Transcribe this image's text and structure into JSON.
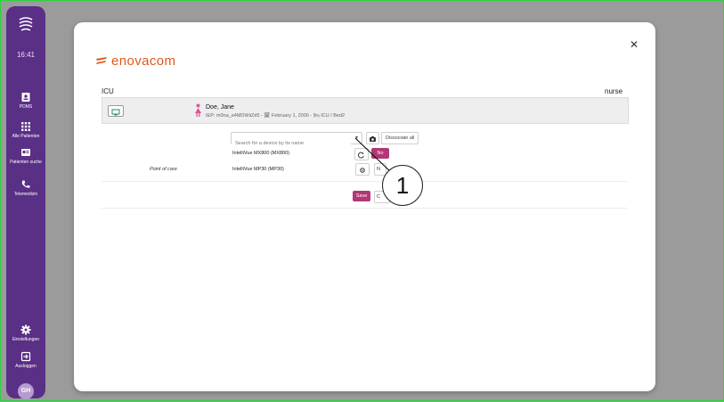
{
  "sidebar": {
    "time": "16:41",
    "items": [
      {
        "label": "PDMS",
        "icon": "badge-icon"
      },
      {
        "label": "Alle Patienten",
        "icon": "grid-icon"
      },
      {
        "label": "Patienten suche",
        "icon": "search-card-icon"
      },
      {
        "label": "Telemedizin",
        "icon": "phone-icon"
      }
    ],
    "bottom_items": [
      {
        "label": "Einstellungen",
        "icon": "gear-icon"
      },
      {
        "label": "Ausloggen",
        "icon": "logout-icon"
      }
    ],
    "avatar_initials": "GH",
    "colors": {
      "background": "#5a2f86"
    }
  },
  "modal": {
    "brand": "enovacom",
    "brand_color": "#e0591e",
    "context_left": "ICU",
    "context_right": "nurse",
    "patient": {
      "name": "Doe, Jane",
      "info": "IEP: m0na_e4MDWiiZd5 - 🗓 February 1, 2000 - 🛏 ICU / Bed2"
    },
    "search": {
      "placeholder": "Search for a device by its name"
    },
    "dissociate_label": "Dissociate all",
    "devices": [
      {
        "name": "IntelliVue MX800 (MX800)",
        "action": "No"
      },
      {
        "name": "IntelliVue MP30 (MP30)",
        "action": "N"
      }
    ],
    "row_label": "Point of care",
    "save_label": "Save",
    "cancel_label": "C",
    "accent": "#b23774"
  },
  "callout": {
    "number": "1"
  }
}
